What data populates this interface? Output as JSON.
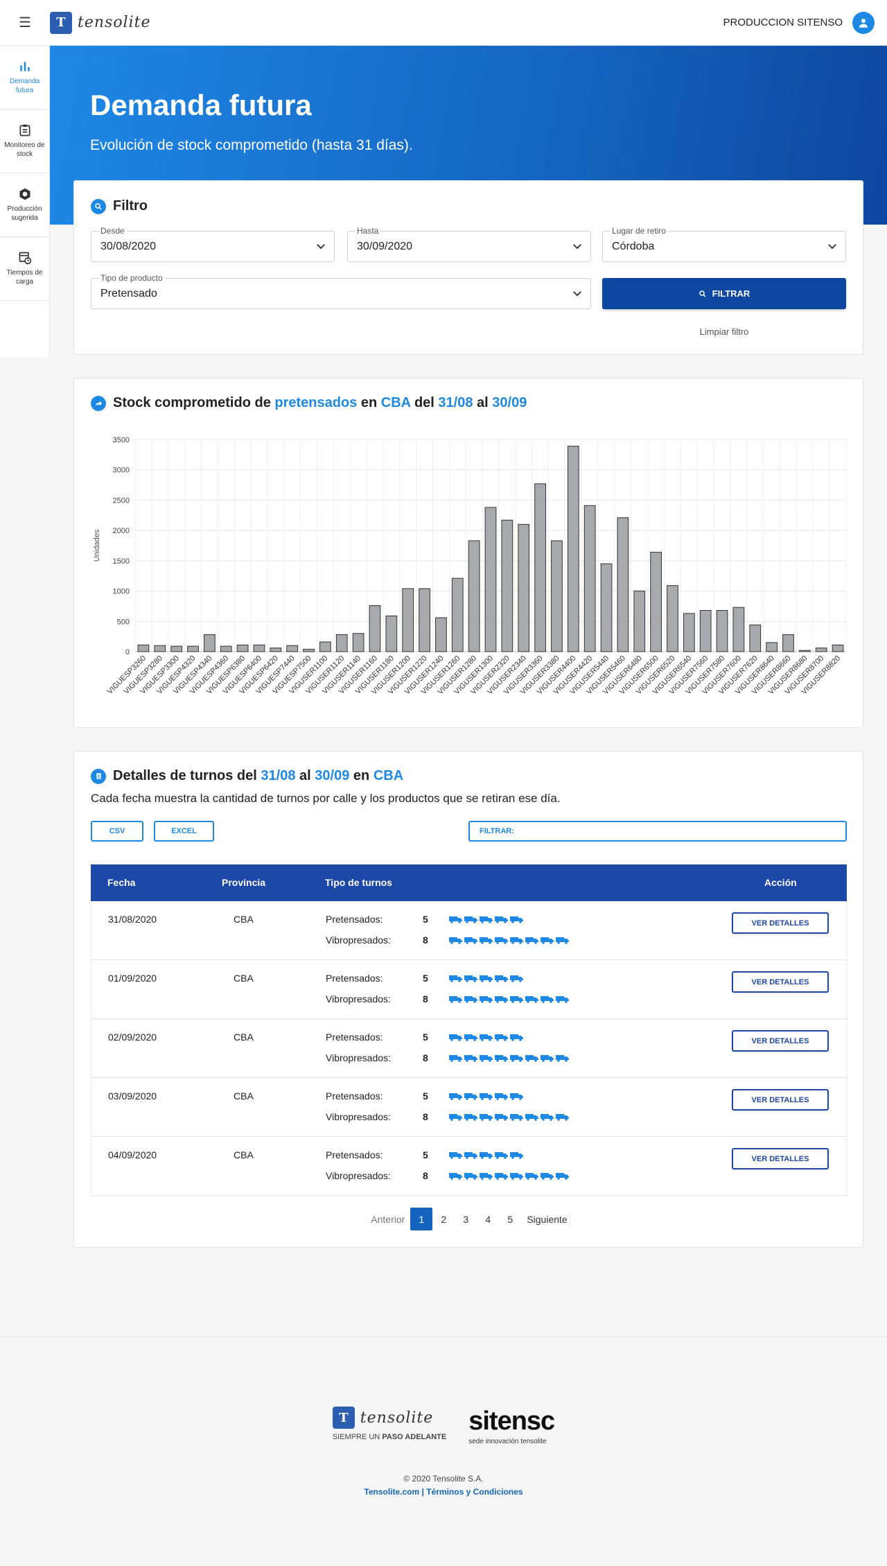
{
  "header": {
    "brand": "tensolite",
    "user_name": "PRODUCCION SITENSO"
  },
  "sidebar": {
    "items": [
      {
        "label": "Demanda futura",
        "icon": "bar-chart-icon",
        "active": true
      },
      {
        "label": "Monitoreo de stock",
        "icon": "clipboard-icon",
        "active": false
      },
      {
        "label": "Producción sugerida",
        "icon": "hexagon-icon",
        "active": false
      },
      {
        "label": "Tiempos de carga",
        "icon": "schedule-icon",
        "active": false
      }
    ]
  },
  "hero": {
    "title": "Demanda futura",
    "subtitle": "Evolución de stock comprometido (hasta 31 días)."
  },
  "filter": {
    "title": "Filtro",
    "desde_label": "Desde",
    "desde_value": "30/08/2020",
    "hasta_label": "Hasta",
    "hasta_value": "30/09/2020",
    "lugar_label": "Lugar de retiro",
    "lugar_value": "Córdoba",
    "tipo_label": "Tipo de producto",
    "tipo_value": "Pretensado",
    "button_label": "FILTRAR",
    "clear_label": "Limpiar filtro"
  },
  "stock_section": {
    "title_pre": "Stock comprometido de",
    "product": "pretensados",
    "word_en": "en",
    "place": "CBA",
    "word_del": "del",
    "from": "31/08",
    "word_al": "al",
    "to": "30/09"
  },
  "chart_data": {
    "type": "bar",
    "ylabel": "Unidades",
    "xlabel": "",
    "ylim": [
      0,
      3500
    ],
    "yticks": [
      0,
      500,
      1000,
      1500,
      2000,
      2500,
      3000,
      3500
    ],
    "grid": true,
    "categories": [
      "VIGUESP3260",
      "VIGUESP3280",
      "VIGUESP3300",
      "VIGUESP4320",
      "VIGUESP4340",
      "VIGUESP4360",
      "VIGUESP6380",
      "VIGUESP6400",
      "VIGUESP6420",
      "VIGUESP7440",
      "VIGUESP7500",
      "VIGUSER1100",
      "VIGUSER1120",
      "VIGUSER1140",
      "VIGUSER1160",
      "VIGUSER1180",
      "VIGUSER1200",
      "VIGUSER1220",
      "VIGUSER1240",
      "VIGUSER1260",
      "VIGUSER1280",
      "VIGUSER1300",
      "VIGUSER2320",
      "VIGUSER2340",
      "VIGUSER3360",
      "VIGUSER3380",
      "VIGUSER4400",
      "VIGUSER4420",
      "VIGUSER5440",
      "VIGUSER5460",
      "VIGUSER6480",
      "VIGUSER6500",
      "VIGUSER6520",
      "VIGUSER6540",
      "VIGUSER7560",
      "VIGUSER7580",
      "VIGUSER7600",
      "VIGUSER7620",
      "VIGUSER8640",
      "VIGUSER8660",
      "VIGUSER8680",
      "VIGUSER8700",
      "VIGUSER8820"
    ],
    "values": [
      110,
      100,
      90,
      90,
      280,
      90,
      110,
      110,
      60,
      100,
      40,
      160,
      280,
      300,
      760,
      590,
      1040,
      1040,
      560,
      1210,
      1830,
      2380,
      2170,
      2100,
      2770,
      1830,
      3390,
      2410,
      1450,
      2210,
      1000,
      1640,
      1090,
      630,
      680,
      680,
      730,
      440,
      150,
      280,
      20,
      60,
      110
    ],
    "bar_color": "#a6a9ad",
    "bar_stroke": "#333333"
  },
  "turnos_section": {
    "title_pre": "Detalles de turnos del",
    "from": "31/08",
    "word_al": "al",
    "to": "30/09",
    "word_en": "en",
    "place": "CBA",
    "description": "Cada fecha muestra la cantidad de turnos por calle y los productos que se retiran ese día.",
    "csv_label": "CSV",
    "excel_label": "EXCEL",
    "filter_placeholder": "FILTRAR:",
    "columns": {
      "fecha": "Fecha",
      "provincia": "Provincia",
      "tipo": "Tipo de turnos",
      "accion": "Acción"
    },
    "rows": [
      {
        "fecha": "31/08/2020",
        "provincia": "CBA",
        "pre_label": "Pretensados:",
        "pre_count": "5",
        "vibro_label": "Vibropresados:",
        "vibro_count": "8",
        "action": "VER DETALLES"
      },
      {
        "fecha": "01/09/2020",
        "provincia": "CBA",
        "pre_label": "Pretensados:",
        "pre_count": "5",
        "vibro_label": "Vibropresados:",
        "vibro_count": "8",
        "action": "VER DETALLES"
      },
      {
        "fecha": "02/09/2020",
        "provincia": "CBA",
        "pre_label": "Pretensados:",
        "pre_count": "5",
        "vibro_label": "Vibropresados:",
        "vibro_count": "8",
        "action": "VER DETALLES"
      },
      {
        "fecha": "03/09/2020",
        "provincia": "CBA",
        "pre_label": "Pretensados:",
        "pre_count": "5",
        "vibro_label": "Vibropresados:",
        "vibro_count": "8",
        "action": "VER DETALLES"
      },
      {
        "fecha": "04/09/2020",
        "provincia": "CBA",
        "pre_label": "Pretensados:",
        "pre_count": "5",
        "vibro_label": "Vibropresados:",
        "vibro_count": "8",
        "action": "VER DETALLES"
      }
    ],
    "pager": {
      "prev": "Anterior",
      "pages": [
        "1",
        "2",
        "3",
        "4",
        "5"
      ],
      "current": "1",
      "next": "Siguiente"
    }
  },
  "footer": {
    "tagline_pre": "SIEMPRE UN",
    "tagline_bold": "PASO ADELANTE",
    "partner": "sitensc",
    "partner_sub": "sede innovación tensolite",
    "copyright": "© 2020 Tensolite S.A.",
    "link1": "Tensolite.com",
    "separator": "|",
    "link2": "Términos y Condiciones"
  },
  "colors": {
    "accent": "#1e88e5",
    "primary_dark": "#0d47a1",
    "table_header": "#1e48a7"
  }
}
